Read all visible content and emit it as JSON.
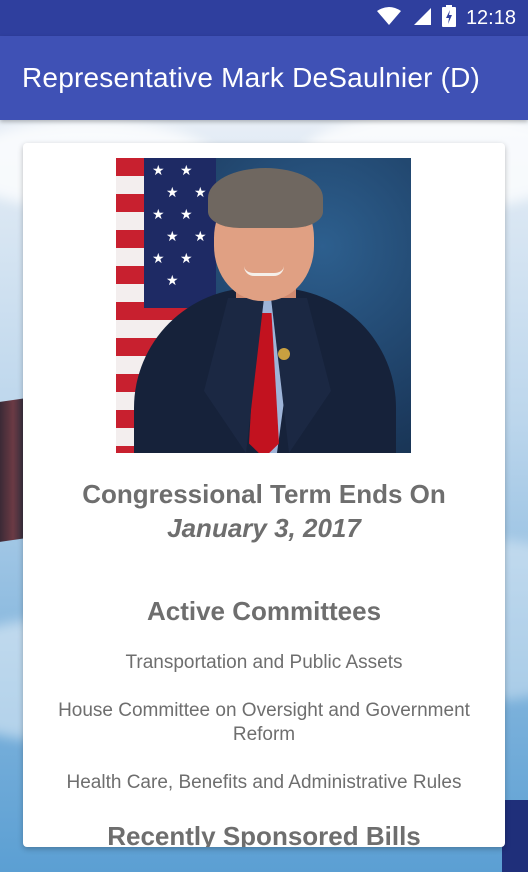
{
  "status_bar": {
    "time": "12:18",
    "icons": [
      "wifi-icon",
      "cell-signal-icon",
      "battery-charging-icon"
    ]
  },
  "app_bar": {
    "title": "Representative Mark DeSaulnier (D)",
    "color": "#3f51b5"
  },
  "card": {
    "portrait": "representative-portrait",
    "term_label": "Congressional Term Ends On",
    "term_date": "January 3, 2017",
    "committees_heading": "Active Committees",
    "committees": [
      "Transportation and Public Assets",
      "House Committee on Oversight and Government Reform",
      "Health Care, Benefits and Administrative Rules"
    ],
    "bills_heading": "Recently Sponsored Bills"
  },
  "colors": {
    "status_bar": "#2f3f9e",
    "text_gray": "#6e6e6e"
  }
}
